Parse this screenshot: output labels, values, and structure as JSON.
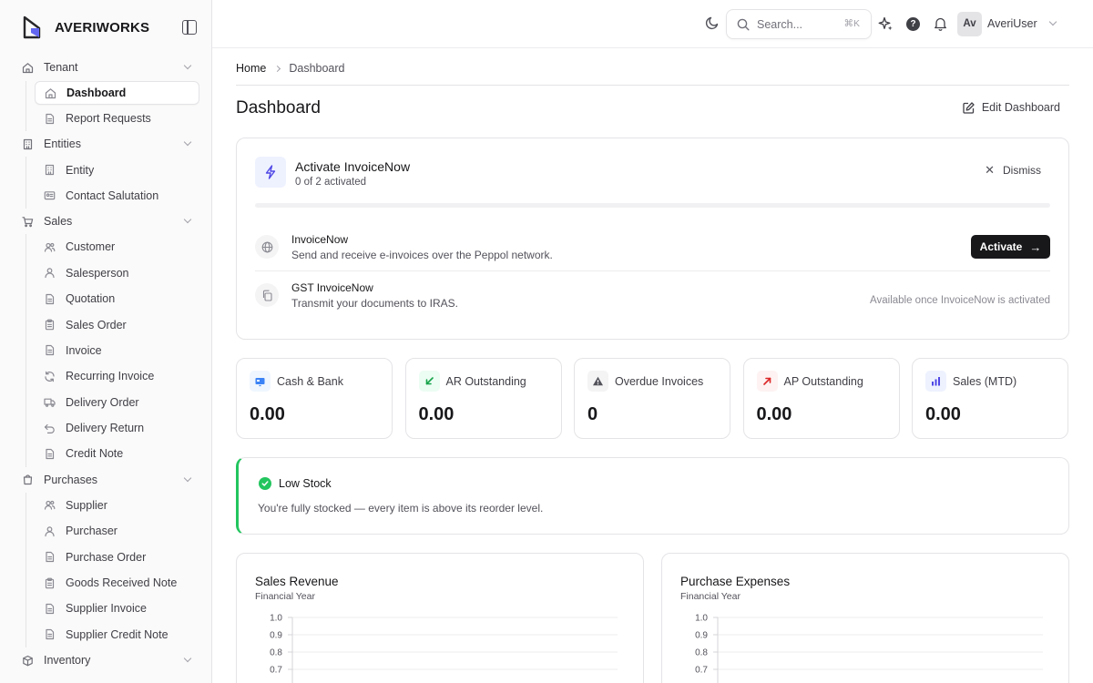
{
  "app": {
    "brand": "AVERIWORKS"
  },
  "sidebar": {
    "groups": [
      {
        "label": "Tenant",
        "icon": "home-icon",
        "items": [
          {
            "label": "Dashboard",
            "icon": "home-icon",
            "active": true
          },
          {
            "label": "Report Requests",
            "icon": "file-icon"
          }
        ]
      },
      {
        "label": "Entities",
        "icon": "building-icon",
        "items": [
          {
            "label": "Entity",
            "icon": "building-icon"
          },
          {
            "label": "Contact Salutation",
            "icon": "id-card-icon"
          }
        ]
      },
      {
        "label": "Sales",
        "icon": "cart-icon",
        "items": [
          {
            "label": "Customer",
            "icon": "users-icon"
          },
          {
            "label": "Salesperson",
            "icon": "user-icon"
          },
          {
            "label": "Quotation",
            "icon": "file-icon"
          },
          {
            "label": "Sales Order",
            "icon": "clipboard-icon"
          },
          {
            "label": "Invoice",
            "icon": "file-icon"
          },
          {
            "label": "Recurring Invoice",
            "icon": "refresh-icon"
          },
          {
            "label": "Delivery Order",
            "icon": "truck-icon"
          },
          {
            "label": "Delivery Return",
            "icon": "undo-icon"
          },
          {
            "label": "Credit Note",
            "icon": "file-icon"
          }
        ]
      },
      {
        "label": "Purchases",
        "icon": "bag-icon",
        "items": [
          {
            "label": "Supplier",
            "icon": "users-icon"
          },
          {
            "label": "Purchaser",
            "icon": "user-icon"
          },
          {
            "label": "Purchase Order",
            "icon": "file-icon"
          },
          {
            "label": "Goods Received Note",
            "icon": "clipboard-icon"
          },
          {
            "label": "Supplier Invoice",
            "icon": "file-icon"
          },
          {
            "label": "Supplier Credit Note",
            "icon": "file-icon"
          }
        ]
      },
      {
        "label": "Inventory",
        "icon": "box-icon",
        "items": []
      }
    ]
  },
  "topbar": {
    "search_placeholder": "Search...",
    "search_shortcut": "⌘K",
    "help_glyph": "?",
    "avatar_initials": "Av",
    "username": "AveriUser"
  },
  "breadcrumb": {
    "home": "Home",
    "current": "Dashboard"
  },
  "page": {
    "title": "Dashboard",
    "edit_label": "Edit Dashboard"
  },
  "activation": {
    "title": "Activate InvoiceNow",
    "subtitle": "0 of 2 activated",
    "progress": 0,
    "dismiss_label": "Dismiss",
    "features": [
      {
        "title": "InvoiceNow",
        "description": "Send and receive e-invoices over the Peppol network.",
        "action_label": "Activate",
        "action_arrow": "→",
        "icon": "globe-icon"
      },
      {
        "title": "GST InvoiceNow",
        "description": "Transmit your documents to IRAS.",
        "note": "Available once InvoiceNow is activated",
        "icon": "copy-icon"
      }
    ]
  },
  "stats": [
    {
      "label": "Cash & Bank",
      "value": "0.00",
      "icon": "bank-card-icon",
      "color": "#3b82f6",
      "bg": "#eff6ff"
    },
    {
      "label": "AR Outstanding",
      "value": "0.00",
      "icon": "arrow-down-left-icon",
      "color": "#16a34a",
      "bg": "#ecfdf3"
    },
    {
      "label": "Overdue Invoices",
      "value": "0",
      "icon": "warning-icon",
      "color": "#52525b",
      "bg": "#f4f4f5"
    },
    {
      "label": "AP Outstanding",
      "value": "0.00",
      "icon": "arrow-up-right-icon",
      "color": "#dc2626",
      "bg": "#fef2f2"
    },
    {
      "label": "Sales (MTD)",
      "value": "0.00",
      "icon": "bar-chart-icon",
      "color": "#4f46e5",
      "bg": "#eef2ff"
    }
  ],
  "low_stock": {
    "title": "Low Stock",
    "message": "You're fully stocked — every item is above its reorder level.",
    "accent": "#22c55e"
  },
  "chart_data": [
    {
      "type": "bar",
      "title": "Sales Revenue",
      "subtitle": "Financial Year",
      "xlabel": "",
      "ylabel": "",
      "ylim": [
        0,
        1.0
      ],
      "yticks": [
        "1.0",
        "0.9",
        "0.8",
        "0.7"
      ],
      "categories": [],
      "values": [],
      "grid": true
    },
    {
      "type": "bar",
      "title": "Purchase Expenses",
      "subtitle": "Financial Year",
      "xlabel": "",
      "ylabel": "",
      "ylim": [
        0,
        1.0
      ],
      "yticks": [
        "1.0",
        "0.9",
        "0.8",
        "0.7"
      ],
      "categories": [],
      "values": [],
      "grid": true
    }
  ]
}
